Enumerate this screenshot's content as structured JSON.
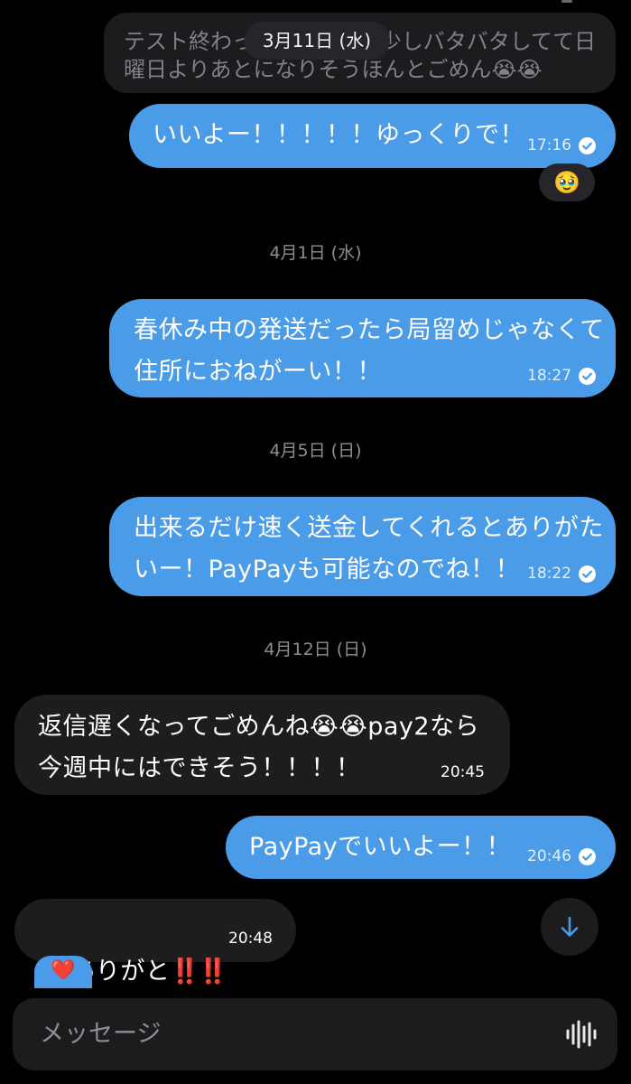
{
  "chat": {
    "messages": [
      {
        "id": "m1",
        "direction": "in",
        "lines": [
          "テスト終わっ",
          "曜日よりあとになりそうほんとごめん😭😭"
        ],
        "line1_tail": "ど少しバタバタしてて日",
        "faded": true
      },
      {
        "id": "m2",
        "direction": "out",
        "lines": [
          "いいよー！！！！！ゆっくりで！"
        ],
        "time": "17:16",
        "read": true,
        "reaction": "🥹"
      },
      {
        "id": "m3",
        "direction": "out",
        "lines": [
          "春休み中の発送だったら局留めじゃなくて",
          "住所におねがーい！！"
        ],
        "time": "18:27",
        "read": true
      },
      {
        "id": "m4",
        "direction": "out",
        "lines": [
          "出来るだけ速く送金してくれるとありがた",
          "いー！PayPayも可能なのでね！！"
        ],
        "time": "18:22",
        "read": true
      },
      {
        "id": "m5",
        "direction": "in",
        "lines": [
          "返信遅くなってごめんね😭😭pay2なら",
          "今週中にはできそう！！！！"
        ],
        "time": "20:45"
      },
      {
        "id": "m6",
        "direction": "out",
        "lines": [
          "PayPayでいいよー！！"
        ],
        "time": "20:46",
        "read": true
      },
      {
        "id": "m7",
        "direction": "in",
        "lines": [
          "ありがと"
        ],
        "emphasis": "‼️‼️",
        "time": "20:48",
        "reaction": "❤️"
      }
    ],
    "date_separators": [
      "4月1日 (水)",
      "4月5日 (日)",
      "4月12日 (日)"
    ],
    "floating_date": "3月11日 (水)"
  },
  "composer": {
    "placeholder": "メッセージ",
    "voice_icon": "waveform-icon"
  },
  "scroll_button": {
    "icon": "arrow-down-icon"
  },
  "colors": {
    "background": "#000000",
    "outgoing_bubble": "#4a9be8",
    "incoming_bubble": "#1d1d1f",
    "accent": "#4a9be8",
    "secondary_text": "#8e8e93"
  }
}
